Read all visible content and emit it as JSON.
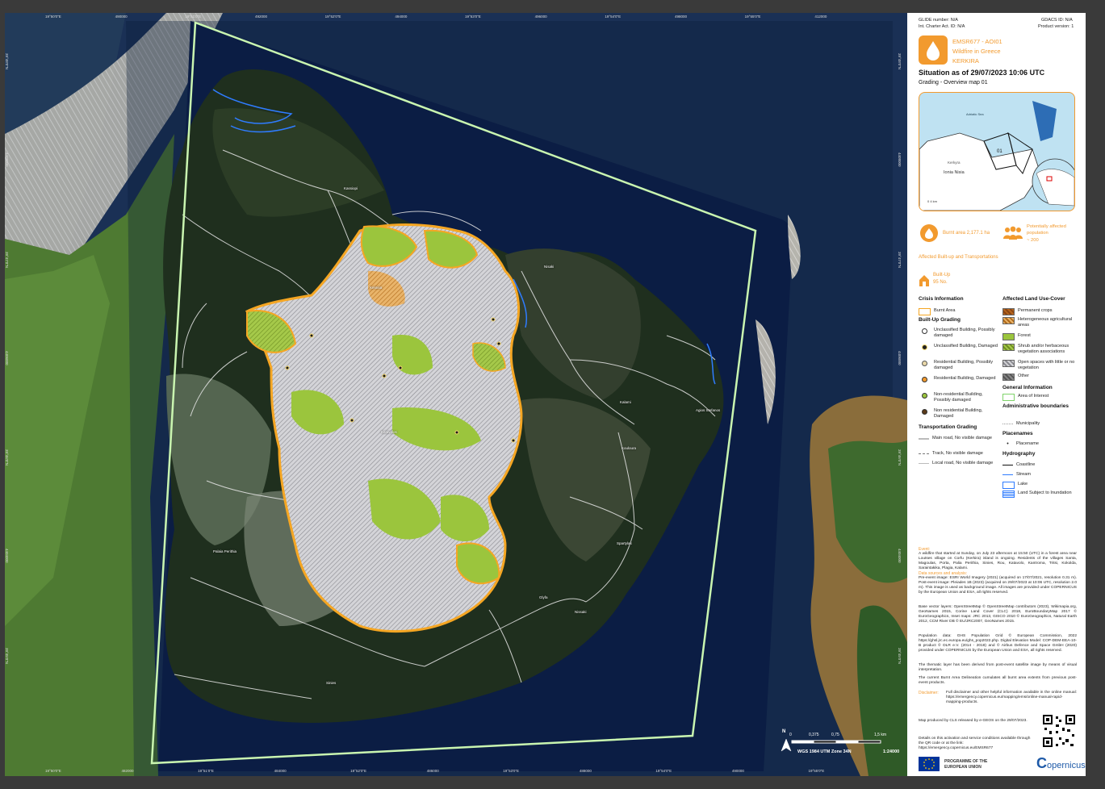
{
  "header": {
    "glide": "GLIDE number: N/A",
    "gdacs": "GDACS ID: N/A",
    "charter": "Int. Charter Act. ID: N/A",
    "product_version": "Product version: 1"
  },
  "title": {
    "code": "EMSR677 - AOI01",
    "event": "Wildfire in Greece",
    "place": "KERKIRA",
    "situation": "Situation as of 29/07/2023 10:06 UTC",
    "subtitle": "Grading - Overview map 01"
  },
  "inset": {
    "sea_label": "Adriatic Sea",
    "country": "Ionia Nisia",
    "city": "Kerkyra",
    "aoi": "01",
    "scale": "0   4 km"
  },
  "stats": {
    "burnt": "Burnt area 2,177.1 ha",
    "population_label": "Potentially affected population",
    "population_value": "~ 200",
    "affected_title": "Affected Built-up and Transportations",
    "builtup_label": "Built-Up",
    "builtup_value": "95 No."
  },
  "legend": {
    "crisis_title": "Crisis Information",
    "burnt_area": "Burnt Area",
    "builtup_grading": "Built-Up Grading",
    "items": [
      "Unclassified Building, Possibly damaged",
      "Unclassified Building, Damaged",
      "Residential Building, Possibly damaged",
      "Residential Building, Damaged",
      "Non-residential Building, Possibly damaged",
      "Non residential Building, Damaged"
    ],
    "transport_title": "Transportation Grading",
    "transport": [
      "Main road, No visible damage",
      "Track, No visible damage",
      "Local road, No visible damage"
    ],
    "landuse_title": "Affected Land Use-Cover",
    "landuse": [
      "Permanent crops",
      "Heterogeneous agricultural areas",
      "Forest",
      "Shrub and/or herbaceous vegetation associations",
      "Open spaces with little or no vegetation",
      "Other"
    ],
    "general_title": "General Information",
    "aoi": "Area of Interest",
    "admin_title": "Administrative boundaries",
    "municipality": "Municipality",
    "placenames_title": "Placenames",
    "placename": "Placename",
    "hydro_title": "Hydrography",
    "hydro": [
      "Coastline",
      "Stream",
      "Lake",
      "Land Subject to Inundation"
    ]
  },
  "colors": {
    "burnt": "#f5a623",
    "forest": "#9bc53d",
    "open": "#c8c8cc",
    "aoi": "#c9f5b0",
    "accent": "#f29a2e",
    "sea": "#12233f"
  },
  "text": {
    "event_title": "Event:",
    "event_body": "A wildfire that started at Sunday, on July 23 afternoon at 15:50 (UTC) in a forest area near Loutses village on Corfu (Kerkira) island is ongoing. Residents of the villages Santa, Magoulas, Porta, Palia Perithia, Sinies, Rou, Katavolo, Kantroma, Tritsi, Kokolda, Saraintakika, Plagia, Kalami.",
    "sources_title": "Data sources and analysis:",
    "sources_body": "Pre-event image: ESRI World Imagery (2021) (acquired on 17/07/2021, resolution 0.31 m). Post-event image: Pleiades 1B (2023) (acquired on 29/07/2023 at 10:06 UTC, resolution 2.0 m). This image is used as background image. All images are provided under COPERNICUS by the European Union and ESA, all rights reserved.",
    "base_vector": "Base vector layers: OpenStreetMap © OpenStreetMap contributors (2023), Wikimapia.org, GeoNames 2015, Corine Land Cover (CLC) 2018, EuroBoundaryMap 2017 © EuroGeographics, Inset maps: JRC 2013, GISCO 2010 © EuroGeographics, Natural Earth 2012, CCM River DB © EU/JRC2007, GeoNames 2015.",
    "population": "Population data: GHS Population Grid © European Commission, 2022 https://ghsl.jrc.ec.europa.eu/ghs_pop2022.php. Digital Elevation Model: COP-DEM-EEA-10-B product © DLR e.V. (2014 - 2018) and © Airbus Defence and Space GmbH (2020) provided under COPERNICUS by the European Union and ESA, all rights reserved.",
    "thematic": "The thematic layer has been derived from post-event satellite image by means of visual interpretation.",
    "current": "The current Burnt Area Delineation cumulates all burnt area extents from previous post-event products.",
    "disclaimer_title": "Disclaimer:",
    "disclaimer_body": "Full disclaimer and other helpful information available in the online manual: https://emergency.copernicus.eu/mapping/ems/online-manual-rapid-mapping-products.",
    "produced": "Map produced by CLS released by e-GEOS on the 29/07/2023.",
    "details": "Details on this activation and service conditions available through the QR code or at the link: https://emergency.copernicus.eu/EMSR677"
  },
  "footer": {
    "programme": "PROGRAMME OF THE EUROPEAN UNION",
    "copernicus": "opernicus",
    "copernicus_c": "C"
  },
  "map": {
    "projection": "WGS 1984 UTM Zone 34N",
    "scale": "1:24000",
    "scalebar": [
      "0",
      "0,375",
      "0,75",
      "1,5 km"
    ],
    "north": "N",
    "places": [
      "Kassiopi",
      "Nisaki",
      "Kerasia",
      "Agios Stefanos",
      "Kalami",
      "Kouloura",
      "Katavolos",
      "Palaia Perithia",
      "Spartylas",
      "Nissaki",
      "Glyfa",
      "Sinies"
    ],
    "top_ticks": [
      "19°50'0\"E",
      "490000",
      "19°51'0\"E",
      "492000",
      "19°52'0\"E",
      "494000",
      "19°53'0\"E",
      "496000",
      "19°54'0\"E",
      "498000",
      "19°55'0\"E",
      "412000"
    ],
    "bottom_ticks": [
      "19°50'0\"E",
      "482000",
      "19°51'0\"E",
      "484000",
      "19°52'0\"E",
      "486000",
      "19°53'0\"E",
      "488000",
      "19°54'0\"E",
      "490000",
      "19°55'0\"E"
    ],
    "left_ticks": [
      "39°48'0\"N",
      "4408000",
      "39°47'0\"N",
      "4406000",
      "39°46'0\"N",
      "4404000",
      "39°45'0\"N"
    ],
    "right_ticks": [
      "39°48'0\"N",
      "4408000",
      "39°47'0\"N",
      "4406000",
      "39°46'0\"N",
      "4404000",
      "39°45'0\"N"
    ]
  }
}
